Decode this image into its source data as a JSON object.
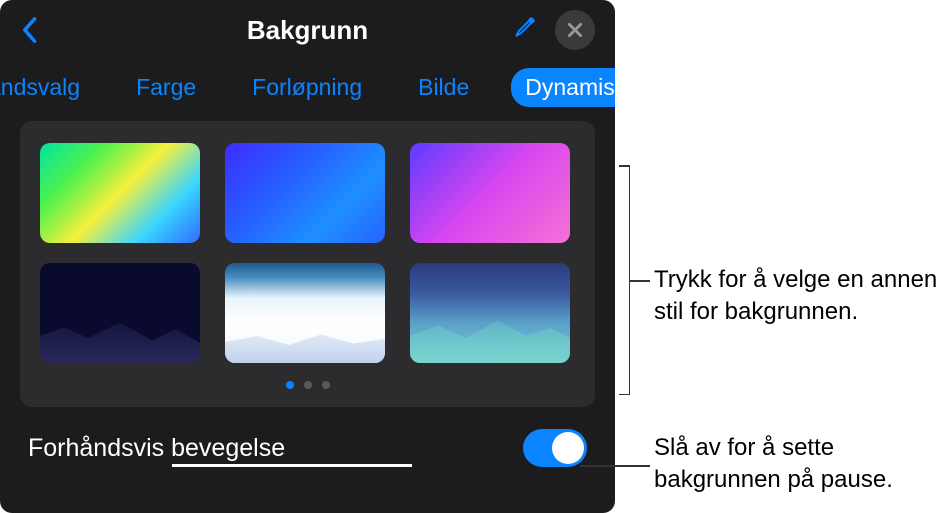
{
  "header": {
    "title": "Bakgrunn"
  },
  "tabs": {
    "items": [
      {
        "label": "åndsvalg"
      },
      {
        "label": "Farge"
      },
      {
        "label": "Forløpning"
      },
      {
        "label": "Bilde"
      },
      {
        "label": "Dynamisk"
      }
    ],
    "activeIndex": 4
  },
  "pagination": {
    "count": 3,
    "activeIndex": 0
  },
  "preview": {
    "label": "Forhåndsvis bevegelse",
    "toggle": true
  },
  "callouts": {
    "grid": "Trykk for å velge en annen stil for bakgrunnen.",
    "toggle": "Slå av for å sette bakgrunnen på pause."
  }
}
